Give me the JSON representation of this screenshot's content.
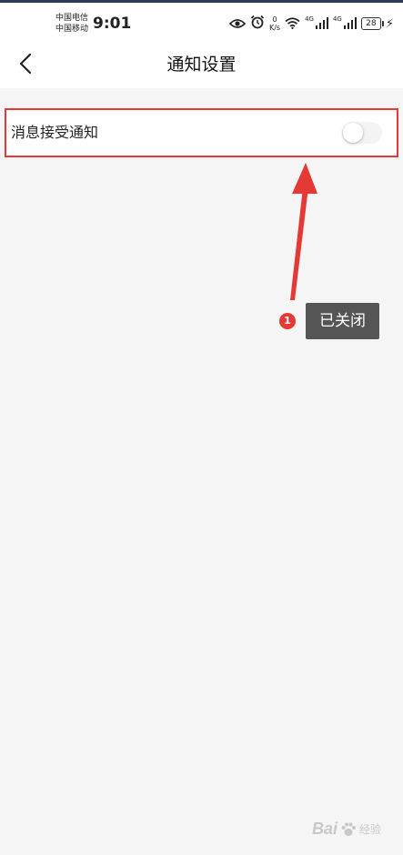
{
  "status_bar": {
    "carrier_1": "中国电信",
    "carrier_2": "中国移动",
    "time": "9:01",
    "net_speed_value": "0",
    "net_speed_unit": "K/s",
    "signal_1_label": "4G",
    "signal_2_label": "4G",
    "battery": "28",
    "icons": [
      "eye-icon",
      "alarm-icon",
      "wifi-icon",
      "signal-icon",
      "battery-icon",
      "charging-icon"
    ]
  },
  "header": {
    "title": "通知设置",
    "back_icon": "chevron-left-icon"
  },
  "settings": {
    "message_notification": {
      "label": "消息接受通知",
      "enabled": false
    }
  },
  "annotation": {
    "step_number": "1",
    "label": "已关闭",
    "color": "#e53935"
  },
  "watermark": {
    "brand": "Bai",
    "suffix": "经验"
  }
}
